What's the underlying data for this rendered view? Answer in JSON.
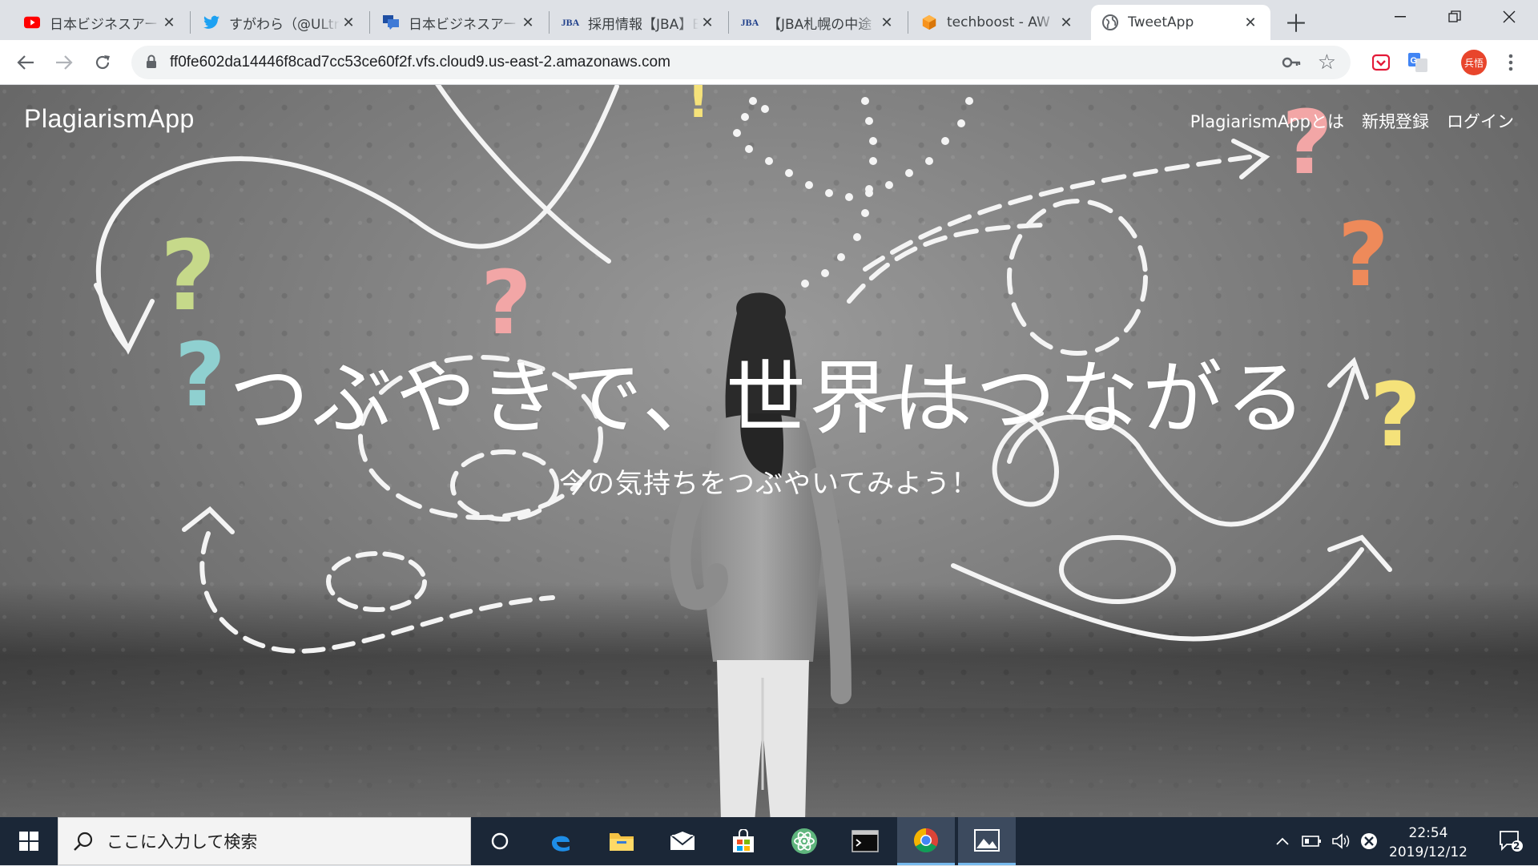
{
  "browser": {
    "tabs": [
      {
        "title": "日本ビジネスアート",
        "favicon": "youtube-icon",
        "color": "#ff0000"
      },
      {
        "title": "すがわら（@ULtr",
        "favicon": "twitter-icon",
        "color": "#1da1f2"
      },
      {
        "title": "日本ビジネスアート",
        "favicon": "jba-chat-icon",
        "color": "#1f4fa3"
      },
      {
        "title": "採用情報【JBA】E",
        "favicon": "jba-logo-icon",
        "color": "#1f3f8a"
      },
      {
        "title": "【JBA札幌の中途",
        "favicon": "jba-logo-icon",
        "color": "#1f3f8a"
      },
      {
        "title": "techboost - AW",
        "favicon": "aws-cube-icon",
        "color": "#f7931e"
      },
      {
        "title": "TweetApp",
        "favicon": "globe-icon",
        "color": "#5f6368"
      }
    ],
    "active_tab_index": 6,
    "url": "ff0fe602da14446f8cad7cc53ce60f2f.vfs.cloud9.us-east-2.amazonaws.com",
    "profile_initials": "兵悟"
  },
  "page": {
    "brand": "PlagiarismApp",
    "nav": {
      "about": "PlagiarismAppとは",
      "signup": "新規登録",
      "login": "ログイン"
    },
    "hero_title": "つぶやきで、世界はつながる",
    "hero_subtitle": "今の気持ちをつぶやいてみよう！"
  },
  "taskbar": {
    "search_placeholder": "ここに入力して検索",
    "time": "22:54",
    "date": "2019/12/12",
    "notification_count": "2"
  }
}
